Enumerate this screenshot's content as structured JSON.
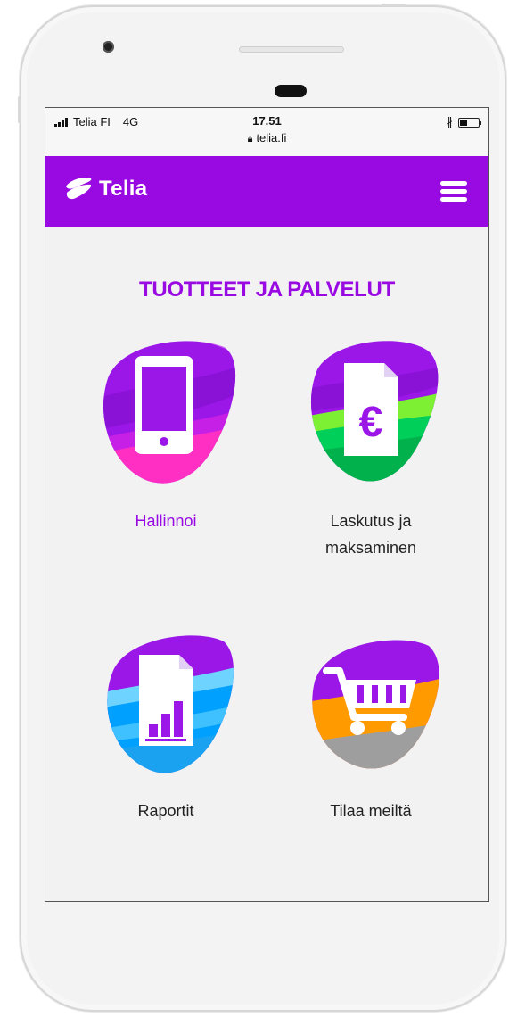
{
  "status_bar": {
    "carrier": "Telia FI",
    "network": "4G",
    "time": "17.51",
    "url": "telia.fi",
    "lock_icon": "lock-icon",
    "bluetooth_icon": "bluetooth-icon"
  },
  "navbar": {
    "brand": "Telia",
    "menu_icon": "hamburger-menu-icon",
    "color": "#990ae3"
  },
  "page": {
    "title": "TUOTTEET JA PALVELUT"
  },
  "tiles": [
    {
      "label": "Hallinnoi",
      "icon": "smartphone-icon",
      "active": true
    },
    {
      "label_line1": "Laskutus ja",
      "label_line2": "maksaminen",
      "icon": "euro-invoice-icon"
    },
    {
      "label": "Raportit",
      "icon": "report-chart-icon"
    },
    {
      "label": "Tilaa meiltä",
      "icon": "shopping-cart-icon"
    }
  ],
  "colors": {
    "brand_purple": "#990ae3",
    "pink": "#ff3ebf",
    "green": "#00d05a",
    "blue": "#00a0ff",
    "orange": "#ff9b00"
  }
}
